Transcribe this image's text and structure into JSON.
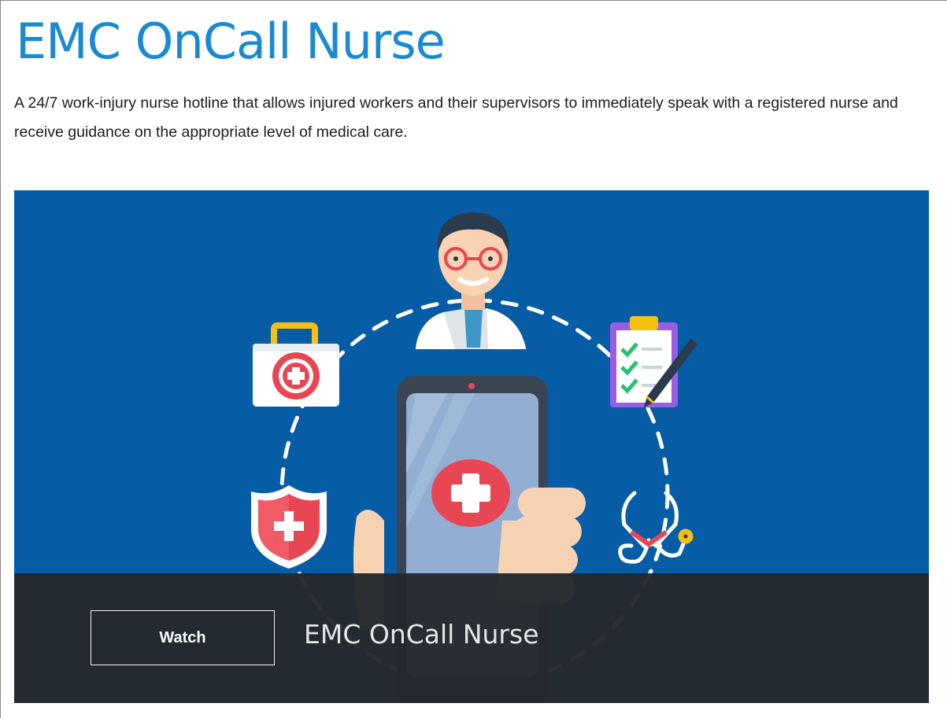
{
  "page": {
    "title": "EMC OnCall Nurse",
    "description": "A 24/7 work-injury nurse hotline that allows injured workers and their supervisors to immediately speak with a registered nurse and receive guidance on the appropriate level of medical care."
  },
  "video": {
    "watch_label": "Watch",
    "title": "EMC OnCall Nurse"
  },
  "icons": {
    "doctor": "doctor-avatar-icon",
    "first_aid": "first-aid-kit-icon",
    "checklist": "clipboard-checklist-icon",
    "shield": "medical-shield-icon",
    "phone": "smartphone-medical-icon",
    "stethoscope": "stethoscope-icon"
  },
  "colors": {
    "title": "#1a8ad0",
    "hero_background": "#065da5",
    "overlay_bar": "#24282e",
    "medical_red": "#e94653"
  }
}
